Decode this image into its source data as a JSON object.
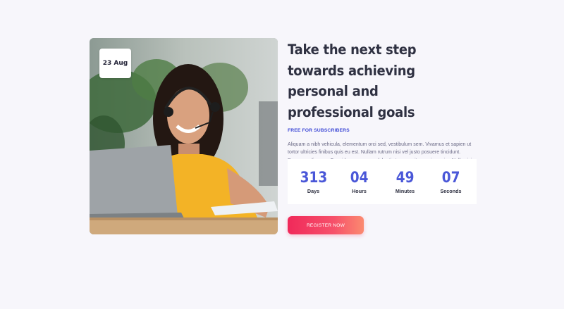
{
  "event": {
    "date": "23 Aug",
    "image_alt": "Woman with headset smiling at laptop"
  },
  "hero": {
    "title": "Take the next step towards achieving personal and professional goals",
    "subtitle": "FREE FOR SUBSCRIBERS",
    "description": "Aliquam a nibh vehicula, elementum orci sed, vestibulum sem. Vivamus et sapien ut tortor ultricies finibus quis eu est. Nullam rutrum nisi vel justo posuere tincidunt. Donec eu diam ex. Cras id sem nec arcu lobortis tempor vitae varius enim. Nulla nisi sem, mollis a luctus in, imperdiet vitae dolor"
  },
  "countdown": {
    "days": {
      "value": "313",
      "label": "Days"
    },
    "hours": {
      "value": "04",
      "label": "Hours"
    },
    "minutes": {
      "value": "49",
      "label": "Minutes"
    },
    "seconds": {
      "value": "07",
      "label": "Seconds"
    }
  },
  "cta": {
    "register_label": "REGISTER NOW"
  },
  "colors": {
    "background": "#f7f6fb",
    "heading": "#2f3142",
    "accent_blue": "#4a57d8",
    "button_start": "#f0295a",
    "button_end": "#fb8a70"
  }
}
